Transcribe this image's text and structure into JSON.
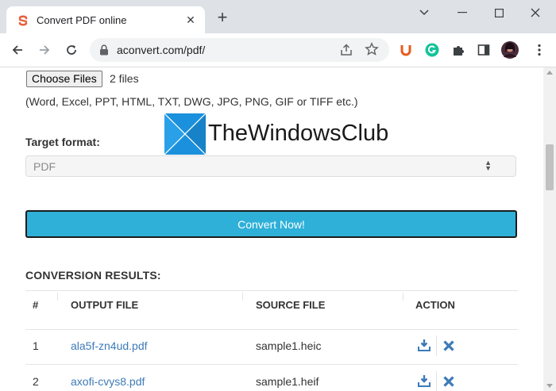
{
  "browser": {
    "tab_title": "Convert PDF online",
    "url": "aconvert.com/pdf/",
    "extensions": [
      "ublock-icon",
      "grammarly-icon",
      "puzzle-extensions-icon",
      "sidepanel-icon"
    ],
    "accent_colors": {
      "tab_favicon": "#e8603c",
      "grammarly": "#15c39a",
      "ublock": "#e85a1e"
    }
  },
  "upload": {
    "choose_label": "Choose Files",
    "files_count": "2 files",
    "formats_note": "(Word, Excel, PPT, HTML, TXT, DWG, JPG, PNG, GIF or TIFF etc.)"
  },
  "target": {
    "label": "Target format:",
    "selected": "PDF"
  },
  "convert_button": "Convert Now!",
  "results": {
    "title": "CONVERSION RESULTS:",
    "headers": [
      "#",
      "OUTPUT FILE",
      "SOURCE FILE",
      "ACTION"
    ],
    "rows": [
      {
        "num": "1",
        "output": "ala5f-zn4ud.pdf",
        "source": "sample1.heic"
      },
      {
        "num": "2",
        "output": "axofi-cvys8.pdf",
        "source": "sample1.heif"
      }
    ]
  },
  "watermark": {
    "text": "TheWindowsClub",
    "color_blue": "#1b90dc"
  }
}
